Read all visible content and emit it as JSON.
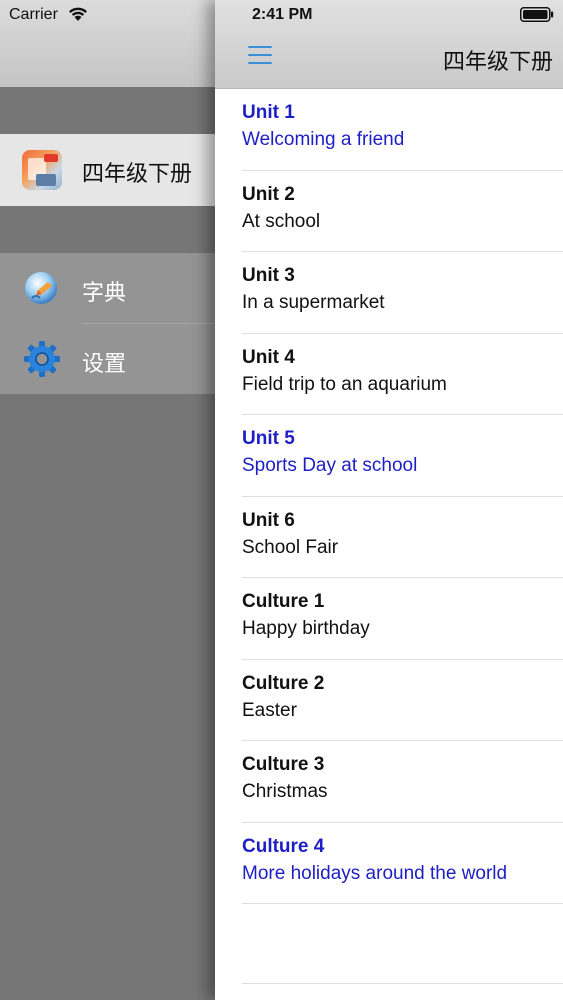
{
  "status": {
    "carrier": "Carrier",
    "time": "2:41 PM"
  },
  "drawer": {
    "book": {
      "title": "四年级下册",
      "icon": "book-cover-icon"
    },
    "menu": [
      {
        "label": "字典",
        "icon": "dictionary-icon"
      },
      {
        "label": "设置",
        "icon": "gear-icon"
      }
    ]
  },
  "navbar": {
    "title": "四年级下册",
    "menu_icon": "hamburger-icon"
  },
  "units": [
    {
      "title": "Unit 1",
      "subtitle": "Welcoming a friend",
      "highlighted": true
    },
    {
      "title": "Unit 2",
      "subtitle": "At school",
      "highlighted": false
    },
    {
      "title": "Unit 3",
      "subtitle": "In a supermarket",
      "highlighted": false
    },
    {
      "title": "Unit 4",
      "subtitle": "Field trip to an aquarium",
      "highlighted": false
    },
    {
      "title": "Unit 5",
      "subtitle": "Sports Day at school",
      "highlighted": true
    },
    {
      "title": "Unit 6",
      "subtitle": "School Fair",
      "highlighted": false
    },
    {
      "title": "Culture 1",
      "subtitle": "Happy birthday",
      "highlighted": false
    },
    {
      "title": "Culture 2",
      "subtitle": "Easter",
      "highlighted": false
    },
    {
      "title": "Culture 3",
      "subtitle": "Christmas",
      "highlighted": false
    },
    {
      "title": "Culture 4",
      "subtitle": "More holidays around the world",
      "highlighted": true
    }
  ],
  "colors": {
    "highlight": "#1d1fc4",
    "accent": "#3a8fd8"
  }
}
